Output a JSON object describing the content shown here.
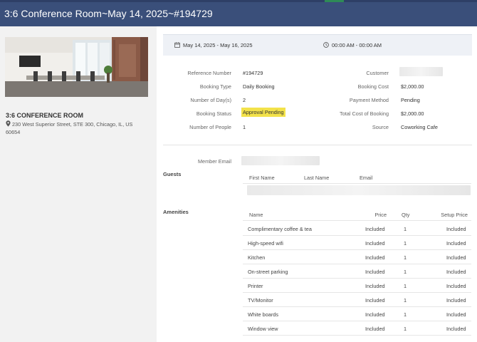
{
  "header": {
    "title": "3:6 Conference Room~May 14, 2025~#194729"
  },
  "sidebar": {
    "room_name": "3:6 CONFERENCE ROOM",
    "address": "230 West Superior Street, STE 300, Chicago, IL, US 60654"
  },
  "datebar": {
    "dates": "May 14, 2025 - May 16, 2025",
    "times": "00:00 AM - 00:00 AM"
  },
  "details": {
    "left": [
      {
        "label": "Reference Number",
        "value": "#194729"
      },
      {
        "label": "Booking Type",
        "value": "Daily Booking"
      },
      {
        "label": "Number of Day(s)",
        "value": "2"
      },
      {
        "label": "Booking Status",
        "value": "Approval Pending"
      },
      {
        "label": "Number of People",
        "value": "1"
      }
    ],
    "right": [
      {
        "label": "Customer",
        "value": ""
      },
      {
        "label": "Booking Cost",
        "value": "$2,000.00"
      },
      {
        "label": "Payment Method",
        "value": "Pending"
      },
      {
        "label": "Total Cost of Booking",
        "value": "$2,000.00"
      },
      {
        "label": "Source",
        "value": "Coworking Cafe"
      }
    ],
    "status_color": "#f3e24a"
  },
  "member_email_label": "Member Email",
  "guests": {
    "title": "Guests",
    "headers": [
      "First Name",
      "Last Name",
      "Email"
    ]
  },
  "amenities": {
    "title": "Amenities",
    "headers": [
      "Name",
      "Price",
      "Qty",
      "Setup Price"
    ],
    "rows": [
      [
        "Complimentary coffee & tea",
        "Included",
        "1",
        "Included"
      ],
      [
        "High-speed wifi",
        "Included",
        "1",
        "Included"
      ],
      [
        "Kitchen",
        "Included",
        "1",
        "Included"
      ],
      [
        "On-street parking",
        "Included",
        "1",
        "Included"
      ],
      [
        "Printer",
        "Included",
        "1",
        "Included"
      ],
      [
        "TV/Monitor",
        "Included",
        "1",
        "Included"
      ],
      [
        "White boards",
        "Included",
        "1",
        "Included"
      ],
      [
        "Window view",
        "Included",
        "1",
        "Included"
      ]
    ]
  },
  "colors": {
    "header_bg": "#3a4f7a",
    "sidebar_bg": "#f2f2f2",
    "datebar_bg": "#eef1f6"
  }
}
